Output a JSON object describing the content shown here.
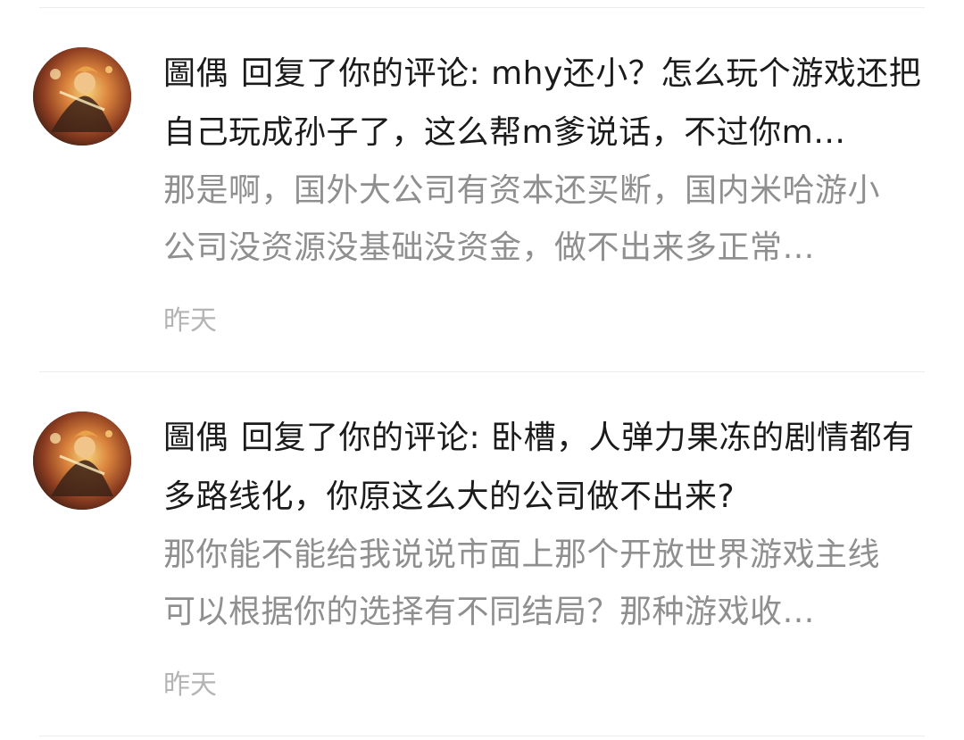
{
  "notifications": [
    {
      "avatar_icon": "user-avatar-illustration",
      "actor": "圖偶",
      "action": "回复了你的评论: ",
      "comment": "mhy还小？怎么玩个游戏还把自己玩成孙子了，这么帮m爹说话，不过你m…",
      "reply": "那是啊，国外大公司有资本还买断，国内米哈游小公司没资源没基础没资金，做不出来多正常…",
      "time": "昨天"
    },
    {
      "avatar_icon": "user-avatar-illustration",
      "actor": "圖偶",
      "action": "回复了你的评论: ",
      "comment": "卧槽，人弹力果冻的剧情都有多路线化，你原这么大的公司做不出来?",
      "reply": "那你能不能给我说说市面上那个开放世界游戏主线可以根据你的选择有不同结局？那种游戏收…",
      "time": "昨天"
    }
  ],
  "colors": {
    "primary_text": "#1b1b1b",
    "secondary_text": "#8f8f8f",
    "time_text": "#b4b4b4",
    "divider": "#ececec"
  }
}
